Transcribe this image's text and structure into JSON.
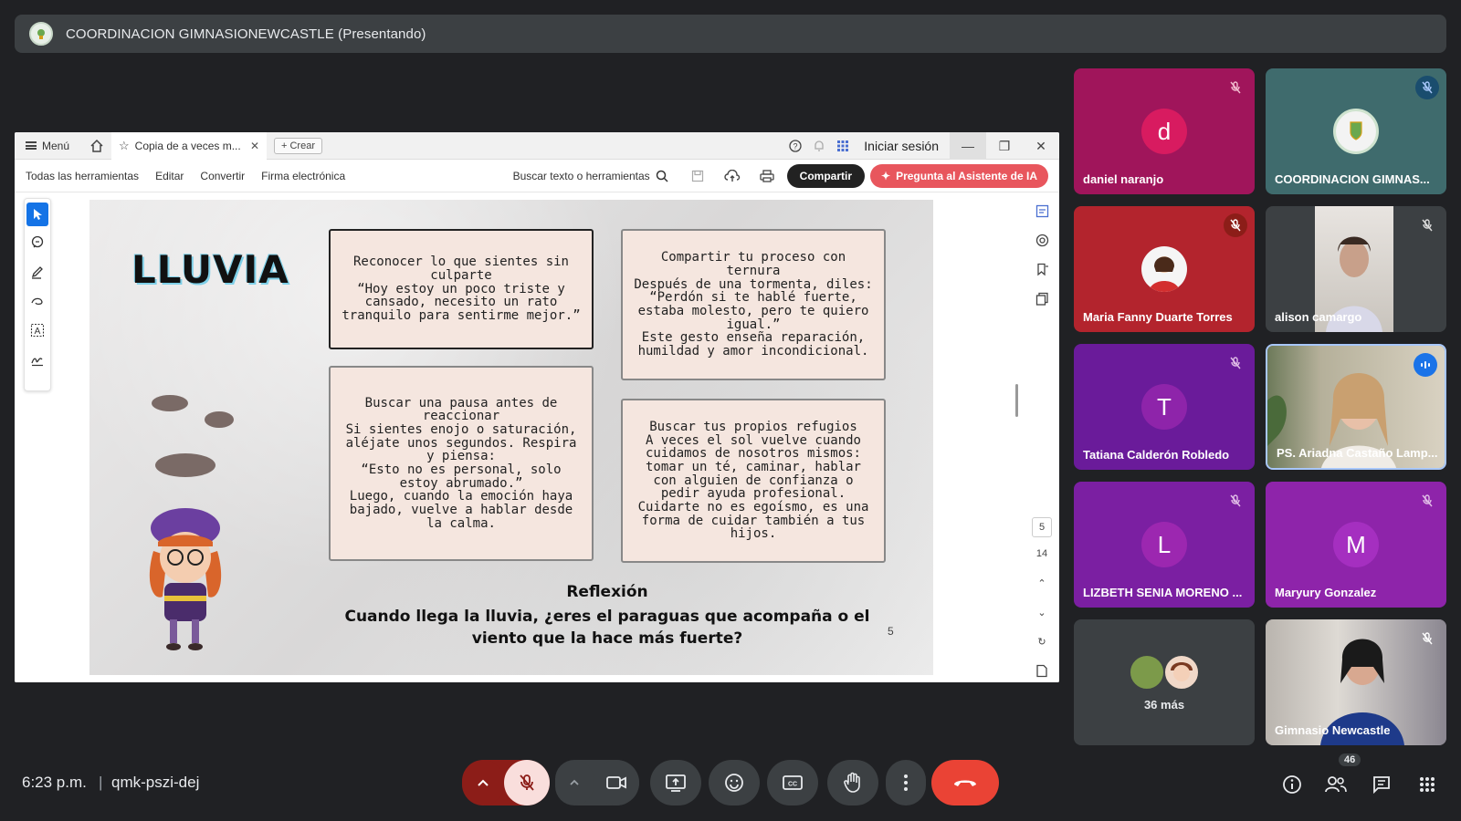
{
  "presenting": {
    "title": "COORDINACION GIMNASIONEWCASTLE (Presentando)"
  },
  "window": {
    "menu_label": "Menú",
    "tab_title": "Copia de a veces m...",
    "new_label": "Crear",
    "login_label": "Iniciar sesión",
    "toolbar": {
      "items": [
        "Todas las herramientas",
        "Editar",
        "Convertir",
        "Firma electrónica"
      ],
      "search_label": "Buscar texto o herramientas",
      "share_label": "Compartir",
      "ai_label": "Pregunta al Asistente de IA"
    },
    "page_current": "5",
    "page_total": "14"
  },
  "slide": {
    "title": "LLUVIA",
    "box1": "Reconocer lo que sientes sin culparte\n“Hoy estoy un poco triste y cansado, necesito un rato tranquilo para sentirme mejor.”",
    "box2": "Compartir tu proceso con ternura\nDespués de una tormenta, diles: “Perdón si te hablé fuerte, estaba molesto, pero te quiero igual.”\nEste gesto enseña reparación, humildad y amor incondicional.",
    "box3": "Buscar una pausa antes de reaccionar\nSi sientes enojo o saturación, aléjate unos segundos. Respira y piensa:\n“Esto no es personal, solo estoy abrumado.”\nLuego, cuando la emoción haya bajado, vuelve a hablar desde la calma.",
    "box4": "Buscar tus propios refugios\nA veces el sol vuelve cuando cuidamos de nosotros mismos: tomar un té, caminar, hablar con alguien de confianza o pedir ayuda profesional.\nCuidarte no es egoísmo, es una forma de cuidar también a tus hijos.",
    "reflexion_title": "Reflexión",
    "reflexion_text": "Cuando llega la lluvia, ¿eres el paraguas que acompaña o el viento que la hace más fuerte?",
    "page_number": "5"
  },
  "participants": {
    "daniel": {
      "name": "daniel naranjo",
      "initial": "d"
    },
    "coord": {
      "name": "COORDINACION GIMNAS..."
    },
    "maria": {
      "name": "Maria Fanny Duarte Torres"
    },
    "alison": {
      "name": "alison camargo"
    },
    "tatiana": {
      "name": "Tatiana Calderón Robledo",
      "initial": "T"
    },
    "ariadna": {
      "name": "PS. Ariadna Castaño Lamp..."
    },
    "lizbeth": {
      "name": "LIZBETH SENIA MORENO ...",
      "initial": "L"
    },
    "maryury": {
      "name": "Maryury Gonzalez",
      "initial": "M"
    },
    "more": {
      "label": "36 más"
    },
    "gimnasio": {
      "name": "Gimnasio Newcastle"
    }
  },
  "bottom": {
    "time": "6:23 p.m.",
    "separator": "|",
    "meeting_code": "qmk-pszi-dej",
    "participant_count": "46"
  },
  "colors": {
    "end_call": "#ea4335",
    "mic_off_bg": "#f9dedc",
    "mic_group": "#8c1d18",
    "background": "#202124"
  }
}
